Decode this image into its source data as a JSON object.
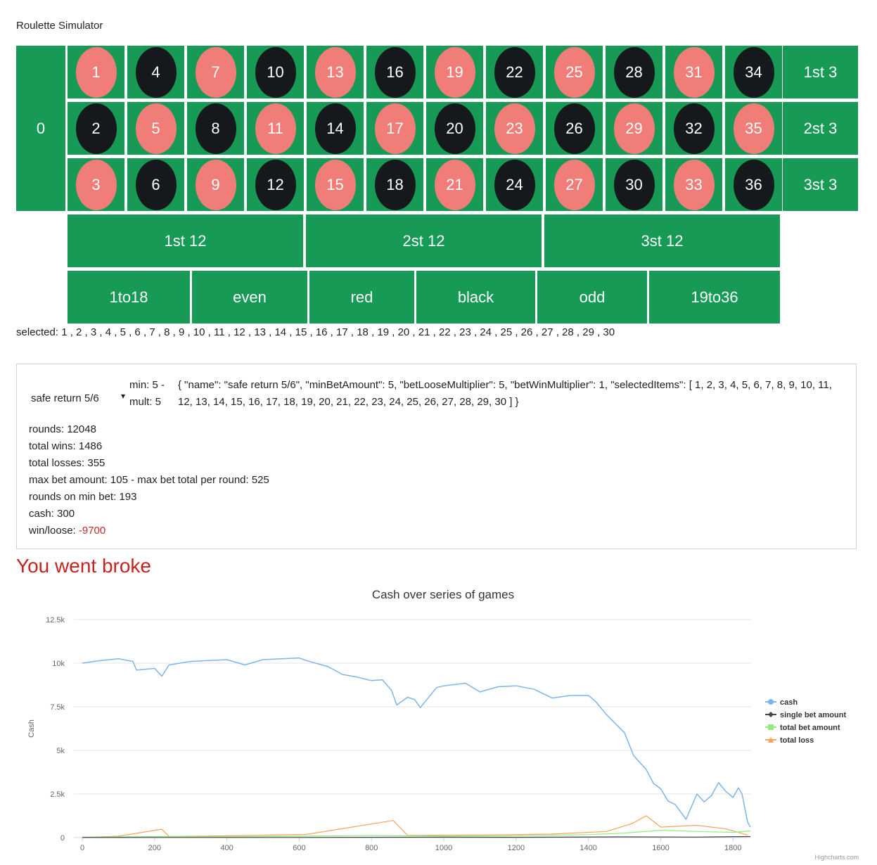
{
  "app": {
    "title": "Roulette Simulator"
  },
  "table": {
    "zero": "0",
    "rows": [
      [
        {
          "n": "1",
          "c": "red"
        },
        {
          "n": "4",
          "c": "black"
        },
        {
          "n": "7",
          "c": "red"
        },
        {
          "n": "10",
          "c": "black"
        },
        {
          "n": "13",
          "c": "red"
        },
        {
          "n": "16",
          "c": "black"
        },
        {
          "n": "19",
          "c": "red"
        },
        {
          "n": "22",
          "c": "black"
        },
        {
          "n": "25",
          "c": "red"
        },
        {
          "n": "28",
          "c": "black"
        },
        {
          "n": "31",
          "c": "red"
        },
        {
          "n": "34",
          "c": "black"
        }
      ],
      [
        {
          "n": "2",
          "c": "black"
        },
        {
          "n": "5",
          "c": "red"
        },
        {
          "n": "8",
          "c": "black"
        },
        {
          "n": "11",
          "c": "red"
        },
        {
          "n": "14",
          "c": "black"
        },
        {
          "n": "17",
          "c": "red"
        },
        {
          "n": "20",
          "c": "black"
        },
        {
          "n": "23",
          "c": "red"
        },
        {
          "n": "26",
          "c": "black"
        },
        {
          "n": "29",
          "c": "red"
        },
        {
          "n": "32",
          "c": "black"
        },
        {
          "n": "35",
          "c": "red"
        }
      ],
      [
        {
          "n": "3",
          "c": "red"
        },
        {
          "n": "6",
          "c": "black"
        },
        {
          "n": "9",
          "c": "red"
        },
        {
          "n": "12",
          "c": "black"
        },
        {
          "n": "15",
          "c": "red"
        },
        {
          "n": "18",
          "c": "black"
        },
        {
          "n": "21",
          "c": "red"
        },
        {
          "n": "24",
          "c": "black"
        },
        {
          "n": "27",
          "c": "red"
        },
        {
          "n": "30",
          "c": "black"
        },
        {
          "n": "33",
          "c": "red"
        },
        {
          "n": "36",
          "c": "black"
        }
      ]
    ],
    "columns": [
      "1st 3",
      "2st 3",
      "3st 3"
    ],
    "dozens": [
      "1st 12",
      "2st 12",
      "3st 12"
    ],
    "outside": [
      "1to18",
      "even",
      "red",
      "black",
      "odd",
      "19to36"
    ]
  },
  "selected_text": "selected: 1 , 2 , 3 , 4 , 5 , 6 , 7 , 8 , 9 , 10 , 11 , 12 , 13 , 14 , 15 , 16 , 17 , 18 , 19 , 20 , 21 , 22 , 23 , 24 , 25 , 26 , 27 , 28 , 29 , 30",
  "strategy": {
    "selected": "safe return 5/6",
    "min_line": "min: 5 -",
    "mult_line": "mult: 5",
    "json_text": "{ \"name\": \"safe return 5/6\", \"minBetAmount\": 5, \"betLooseMultiplier\": 5, \"betWinMultiplier\": 1, \"selectedItems\": [ 1, 2, 3, 4, 5, 6, 7, 8, 9, 10, 11, 12, 13, 14, 15, 16, 17, 18, 19, 20, 21, 22, 23, 24, 25, 26, 27, 28, 29, 30 ] }"
  },
  "stats": {
    "rounds": "rounds: 12048",
    "total_wins": "total wins: 1486",
    "total_losses": "total losses: 355",
    "max_bet": "max bet amount: 105 - max bet total per round: 525",
    "rounds_min_bet": "rounds on min bet: 193",
    "cash": "cash: 300",
    "winloose_label": "win/loose: ",
    "winloose_value": "-9700"
  },
  "broke_message": "You went broke",
  "credit": "Highcharts.com",
  "colors": {
    "table_green": "#179a55",
    "red": "#f07d78",
    "black": "#15191c",
    "cash": "#7cb5ec",
    "single": "#434348",
    "total_bet": "#90ed7d",
    "total_loss": "#f7a35c"
  },
  "chart_data": {
    "type": "line",
    "title": "Cash over series of games",
    "ylabel": "Cash",
    "xlim": [
      0,
      1850
    ],
    "ylim": [
      0,
      12500
    ],
    "x_ticks": [
      "0",
      "200",
      "400",
      "600",
      "800",
      "1000",
      "1200",
      "1400",
      "1600",
      "1800"
    ],
    "y_ticks": [
      "0",
      "2.5k",
      "5k",
      "7.5k",
      "10k",
      "12.5k"
    ],
    "legend_position": "right",
    "series": [
      {
        "name": "cash",
        "color": "#7cb5ec",
        "points": [
          [
            0,
            10000
          ],
          [
            50,
            10150
          ],
          [
            100,
            10250
          ],
          [
            140,
            10100
          ],
          [
            150,
            9600
          ],
          [
            200,
            9700
          ],
          [
            220,
            9250
          ],
          [
            240,
            9900
          ],
          [
            300,
            10100
          ],
          [
            400,
            10200
          ],
          [
            450,
            9900
          ],
          [
            500,
            10200
          ],
          [
            600,
            10300
          ],
          [
            620,
            10150
          ],
          [
            680,
            9800
          ],
          [
            720,
            9350
          ],
          [
            760,
            9200
          ],
          [
            800,
            9000
          ],
          [
            830,
            9050
          ],
          [
            855,
            8450
          ],
          [
            870,
            7600
          ],
          [
            900,
            8050
          ],
          [
            920,
            7900
          ],
          [
            935,
            7450
          ],
          [
            980,
            8600
          ],
          [
            1000,
            8700
          ],
          [
            1060,
            8850
          ],
          [
            1100,
            8350
          ],
          [
            1150,
            8650
          ],
          [
            1200,
            8700
          ],
          [
            1250,
            8500
          ],
          [
            1300,
            8000
          ],
          [
            1350,
            8150
          ],
          [
            1400,
            8150
          ],
          [
            1420,
            7800
          ],
          [
            1450,
            7050
          ],
          [
            1500,
            6000
          ],
          [
            1525,
            4700
          ],
          [
            1560,
            3900
          ],
          [
            1580,
            3100
          ],
          [
            1600,
            2800
          ],
          [
            1620,
            2100
          ],
          [
            1640,
            1900
          ],
          [
            1670,
            1050
          ],
          [
            1700,
            2500
          ],
          [
            1720,
            2050
          ],
          [
            1740,
            2400
          ],
          [
            1760,
            3150
          ],
          [
            1780,
            2650
          ],
          [
            1800,
            2300
          ],
          [
            1815,
            2850
          ],
          [
            1825,
            2500
          ],
          [
            1840,
            900
          ],
          [
            1848,
            600
          ]
        ]
      },
      {
        "name": "single bet amount",
        "color": "#434348",
        "points": [
          [
            0,
            5
          ],
          [
            300,
            10
          ],
          [
            600,
            10
          ],
          [
            900,
            20
          ],
          [
            1200,
            15
          ],
          [
            1500,
            40
          ],
          [
            1700,
            30
          ],
          [
            1848,
            60
          ]
        ]
      },
      {
        "name": "total bet amount",
        "color": "#90ed7d",
        "points": [
          [
            0,
            25
          ],
          [
            200,
            60
          ],
          [
            400,
            50
          ],
          [
            600,
            80
          ],
          [
            800,
            120
          ],
          [
            1000,
            80
          ],
          [
            1200,
            100
          ],
          [
            1400,
            170
          ],
          [
            1500,
            260
          ],
          [
            1600,
            420
          ],
          [
            1700,
            350
          ],
          [
            1800,
            300
          ],
          [
            1848,
            380
          ]
        ]
      },
      {
        "name": "total loss",
        "color": "#f7a35c",
        "points": [
          [
            0,
            0
          ],
          [
            100,
            80
          ],
          [
            220,
            480
          ],
          [
            240,
            60
          ],
          [
            400,
            100
          ],
          [
            620,
            180
          ],
          [
            860,
            980
          ],
          [
            900,
            120
          ],
          [
            1100,
            150
          ],
          [
            1300,
            200
          ],
          [
            1450,
            350
          ],
          [
            1520,
            800
          ],
          [
            1560,
            1250
          ],
          [
            1600,
            600
          ],
          [
            1700,
            700
          ],
          [
            1780,
            500
          ],
          [
            1840,
            150
          ]
        ]
      }
    ]
  }
}
